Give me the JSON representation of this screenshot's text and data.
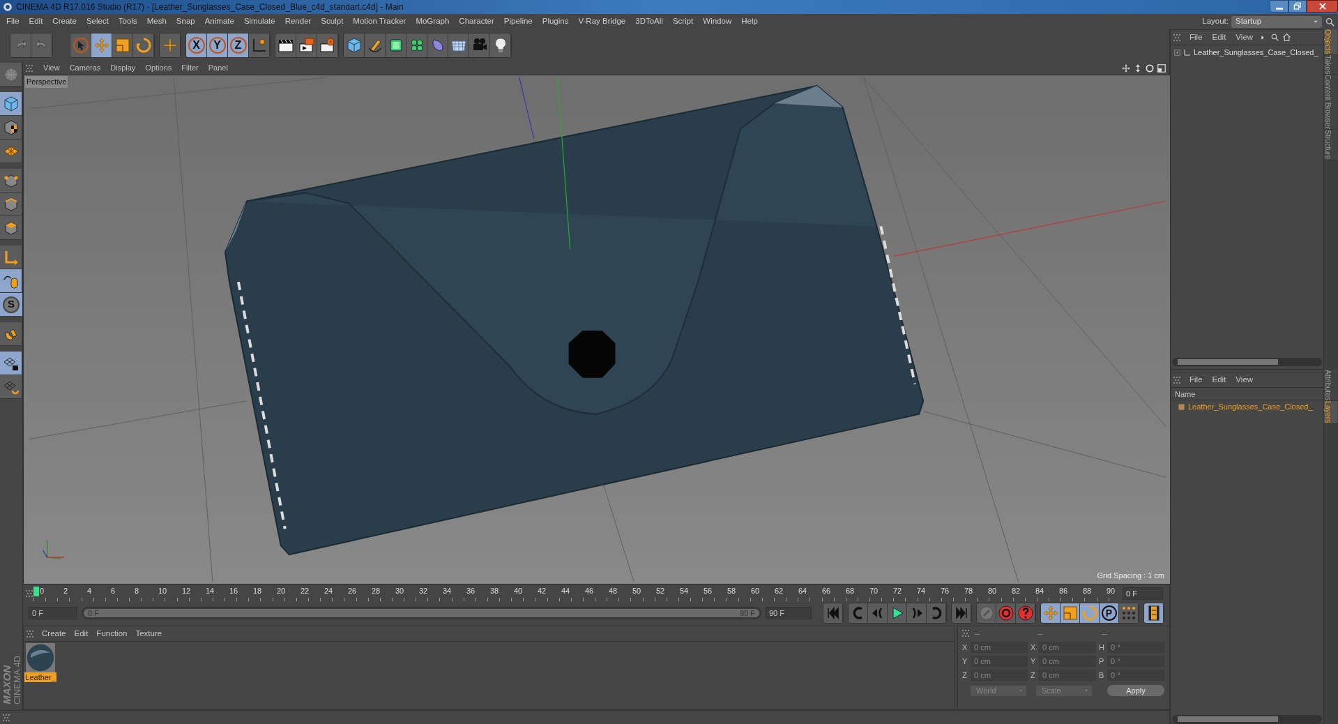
{
  "window": {
    "title": "CINEMA 4D R17.016 Studio (R17) - [Leather_Sunglasses_Case_Closed_Blue_c4d_standart.c4d] - Main"
  },
  "menu": [
    "File",
    "Edit",
    "Create",
    "Select",
    "Tools",
    "Mesh",
    "Snap",
    "Animate",
    "Simulate",
    "Render",
    "Sculpt",
    "Motion Tracker",
    "MoGraph",
    "Character",
    "Pipeline",
    "Plugins",
    "V-Ray Bridge",
    "3DToAll",
    "Script",
    "Window",
    "Help"
  ],
  "layout": {
    "label": "Layout:",
    "value": "Startup"
  },
  "toolbar": {
    "axis_buttons": [
      "X",
      "Y",
      "Z"
    ]
  },
  "left_tools": {
    "snap_label": "S"
  },
  "viewport": {
    "menu": [
      "View",
      "Cameras",
      "Display",
      "Options",
      "Filter",
      "Panel"
    ],
    "camera": "Perspective",
    "grid_spacing": "Grid Spacing : 1 cm"
  },
  "timeline": {
    "ruler": [
      "0",
      "2",
      "4",
      "6",
      "8",
      "10",
      "12",
      "14",
      "16",
      "18",
      "20",
      "22",
      "24",
      "26",
      "28",
      "30",
      "32",
      "34",
      "36",
      "38",
      "40",
      "42",
      "44",
      "46",
      "48",
      "50",
      "52",
      "54",
      "56",
      "58",
      "60",
      "62",
      "64",
      "66",
      "68",
      "70",
      "72",
      "74",
      "76",
      "78",
      "80",
      "82",
      "84",
      "86",
      "88",
      "90"
    ],
    "current_frame": "0 F",
    "start_field": "0 F",
    "range_start": "0 F",
    "range_end": "90 F",
    "end_field": "90 F",
    "key_label": "P",
    "range": {
      "level": 1
    }
  },
  "materials": {
    "menu": [
      "Create",
      "Edit",
      "Function",
      "Texture"
    ],
    "items": [
      {
        "name": "Leather_"
      }
    ]
  },
  "coordinates": {
    "headers": [
      "--",
      "--",
      "--"
    ],
    "rows": [
      {
        "fields": [
          {
            "axis": "X",
            "value": "0 cm"
          },
          {
            "axis": "X",
            "value": "0 cm"
          },
          {
            "axis": "H",
            "value": "0 °"
          }
        ]
      },
      {
        "fields": [
          {
            "axis": "Y",
            "value": "0 cm"
          },
          {
            "axis": "Y",
            "value": "0 cm"
          },
          {
            "axis": "P",
            "value": "0 °"
          }
        ]
      },
      {
        "fields": [
          {
            "axis": "Z",
            "value": "0 cm"
          },
          {
            "axis": "Z",
            "value": "0 cm"
          },
          {
            "axis": "B",
            "value": "0 °"
          }
        ]
      }
    ],
    "dropdowns": [
      "World",
      "Scale"
    ],
    "apply": "Apply"
  },
  "object_manager": {
    "menu": [
      "File",
      "Edit",
      "View"
    ],
    "objects": [
      {
        "name": "Leather_Sunglasses_Case_Closed_"
      }
    ]
  },
  "layer_manager": {
    "menu": [
      "File",
      "Edit",
      "View"
    ],
    "column": "Name",
    "layers": [
      {
        "name": "Leather_Sunglasses_Case_Closed_"
      }
    ]
  },
  "side_tabs_top": [
    {
      "label": "Objects",
      "selected": true
    },
    {
      "label": "Takes",
      "selected": false
    },
    {
      "label": "Content Browser",
      "selected": false
    },
    {
      "label": "Structure",
      "selected": false
    }
  ],
  "side_tabs_bottom": [
    {
      "label": "Attributes",
      "selected": false
    },
    {
      "label": "Layers",
      "selected": true
    }
  ],
  "brand": {
    "maker": "MAXON",
    "product": "CINEMA 4D"
  }
}
